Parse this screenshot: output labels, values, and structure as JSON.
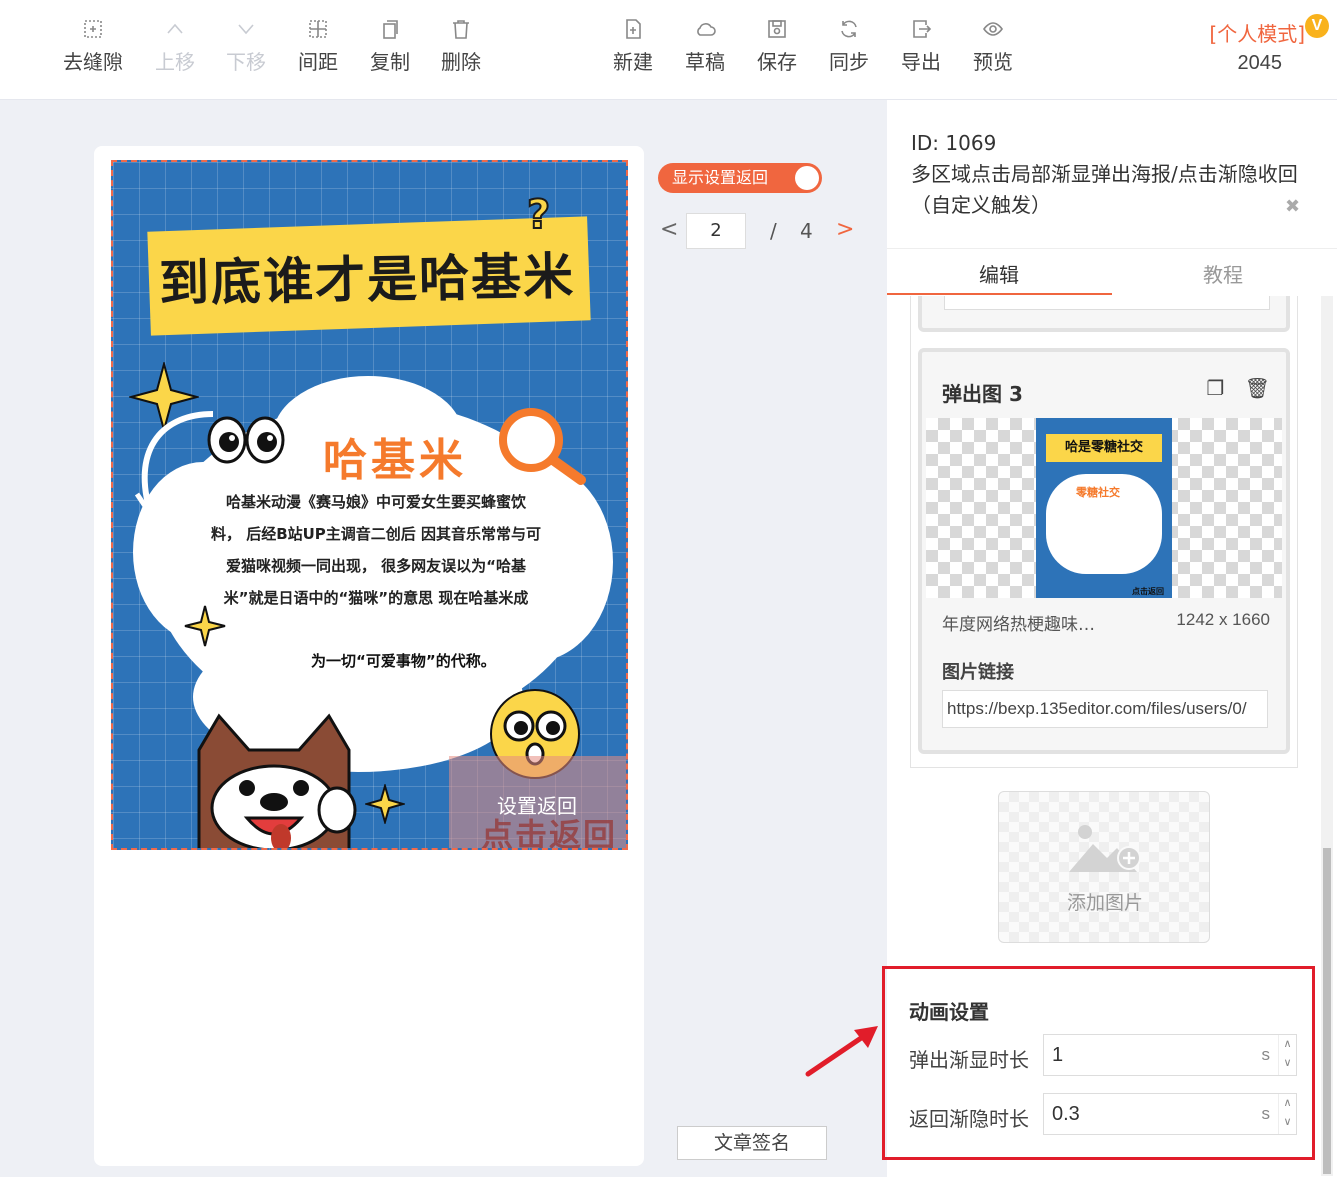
{
  "toolbar": {
    "left_tools": [
      {
        "label": "去缝隙",
        "icon": "remove-gap-icon",
        "disabled": false
      },
      {
        "label": "上移",
        "icon": "chevron-up-icon",
        "disabled": true
      },
      {
        "label": "下移",
        "icon": "chevron-down-icon",
        "disabled": true
      },
      {
        "label": "间距",
        "icon": "spacing-icon",
        "disabled": false
      },
      {
        "label": "复制",
        "icon": "copy-icon",
        "disabled": false
      },
      {
        "label": "删除",
        "icon": "trash-icon",
        "disabled": false
      }
    ],
    "right_tools": [
      {
        "label": "新建",
        "icon": "new-file-icon"
      },
      {
        "label": "草稿",
        "icon": "cloud-icon"
      },
      {
        "label": "保存",
        "icon": "save-icon"
      },
      {
        "label": "同步",
        "icon": "sync-icon"
      },
      {
        "label": "导出",
        "icon": "export-icon"
      },
      {
        "label": "预览",
        "icon": "eye-icon"
      }
    ],
    "mode_label": "[个人模式]",
    "mode_badge": "V",
    "mode_count": "2045"
  },
  "poster": {
    "banner_title": "到底谁才是哈基米",
    "cloud_title": "哈基米",
    "cloud_lines": [
      "哈基米动漫《赛马娘》中可爱女生要买蜂蜜饮",
      "料， 后经B站UP主调音二创后 因其音乐常常与可",
      "爱猫咪视频一同出现， 很多网友误以为“哈基",
      "米”就是日语中的“猫咪”的意思 现在哈基米成"
    ],
    "cloud_foot": "为一切“可爱事物”的代称。",
    "overlay_label": "设置返回",
    "overlay_big": "点击返回"
  },
  "controls": {
    "toggle_label": "显示设置返回",
    "page_current": "2",
    "page_sep": "/",
    "page_total": "4",
    "sign_button": "文章签名"
  },
  "panel": {
    "id_line": "ID: 1069",
    "title": "多区域点击局部渐显弹出海报/点击渐隐收回（自定义触发）",
    "tabs": [
      "编辑",
      "教程"
    ],
    "card": {
      "title": "弹出图 3",
      "thumb_banner": "哈是零糖社交",
      "thumb_title": "零糖社交",
      "thumb_foot": "点击返回",
      "caption": "年度网络热梗趣味…",
      "dims": "1242 x 1660",
      "link_label": "图片链接",
      "link_value": "https://bexp.135editor.com/files/users/0/"
    },
    "add_image_label": "添加图片",
    "animation": {
      "title": "动画设置",
      "rows": [
        {
          "label": "弹出渐显时长",
          "value": "1",
          "unit": "s"
        },
        {
          "label": "返回渐隐时长",
          "value": "0.3",
          "unit": "s"
        }
      ]
    }
  },
  "colors": {
    "accent": "#f0663f",
    "poster_blue": "#2d73b8",
    "banner_yellow": "#fbd649",
    "highlight_red": "#e11d2a"
  }
}
